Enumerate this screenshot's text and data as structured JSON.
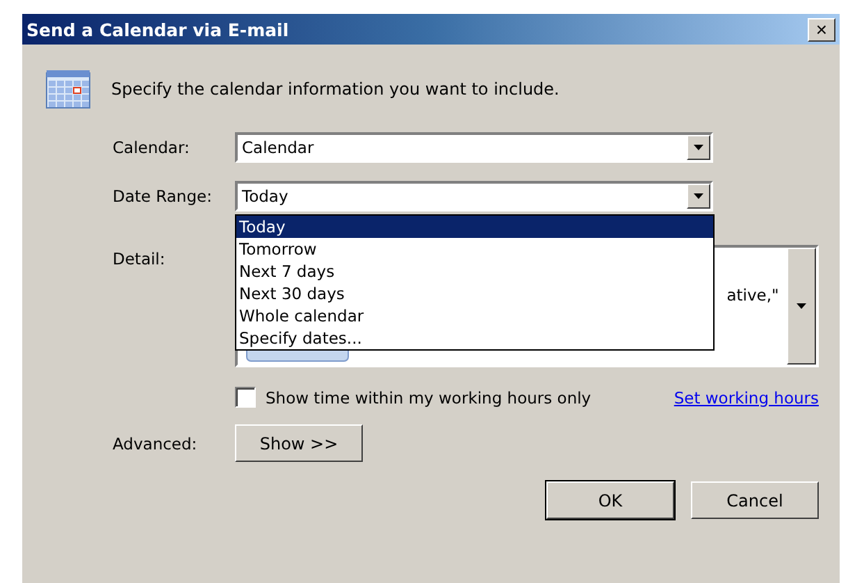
{
  "window": {
    "title": "Send a Calendar via E-mail",
    "close": "×"
  },
  "intro": "Specify the calendar information you want to include.",
  "calendar": {
    "label": "Calendar:",
    "value": "Calendar"
  },
  "date_range": {
    "label": "Date Range:",
    "value": "Today",
    "expanded": true,
    "options": [
      {
        "label": "Today",
        "selected": true
      },
      {
        "label": "Tomorrow",
        "selected": false
      },
      {
        "label": "Next 7 days",
        "selected": false
      },
      {
        "label": "Next 30 days",
        "selected": false
      },
      {
        "label": "Whole calendar",
        "selected": false
      },
      {
        "label": "Specify dates...",
        "selected": false
      }
    ]
  },
  "detail": {
    "label": "Detail:",
    "text": "ative,\""
  },
  "working_hours": {
    "label": "Show time within my working hours only",
    "checked": false,
    "link": "Set working hours"
  },
  "advanced": {
    "label": "Advanced:",
    "button": "Show >>"
  },
  "buttons": [
    "OK",
    "Cancel"
  ]
}
